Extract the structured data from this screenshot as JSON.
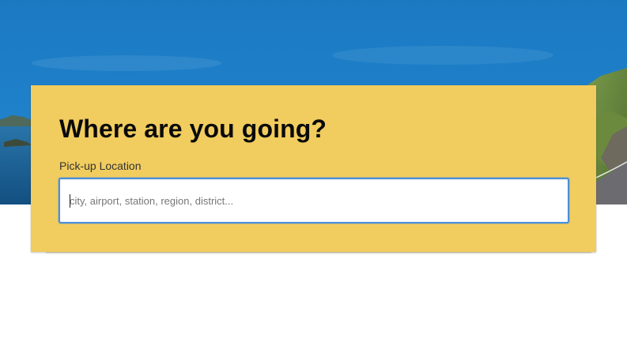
{
  "hero": {
    "image_icon": "coastal-road-landscape"
  },
  "search": {
    "title": "Where are you going?",
    "pickup_label": "Pick-up Location",
    "pickup_placeholder": "city, airport, station, region, district...",
    "pickup_value": ""
  },
  "colors": {
    "card_background": "#f1cc5e",
    "input_focus_border": "#4a90d9",
    "sky": "#1b7bc4",
    "sea": "#1a5f95"
  }
}
